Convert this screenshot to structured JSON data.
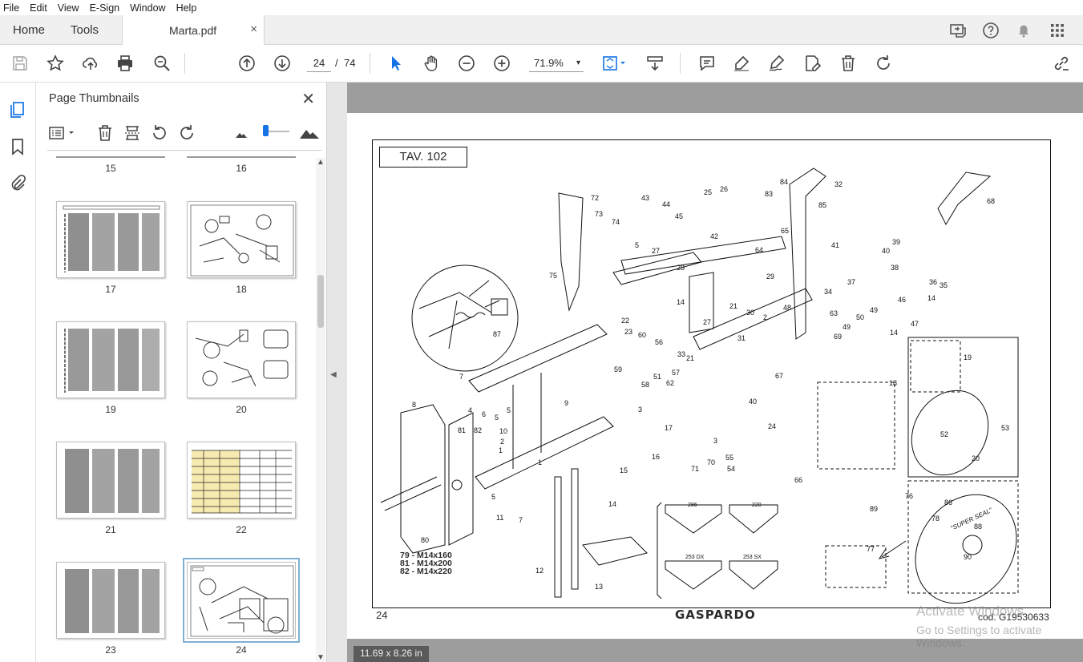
{
  "menu": [
    "File",
    "Edit",
    "View",
    "E-Sign",
    "Window",
    "Help"
  ],
  "tabs": {
    "home": "Home",
    "tools": "Tools",
    "document": "Marta.pdf",
    "close": "×"
  },
  "toolbar": {
    "current_page": "24",
    "page_separator": "/",
    "total_pages": "74",
    "zoom": "71.9%",
    "zoom_arrow": "▾"
  },
  "icons": {
    "top_right": [
      "share-screen-icon",
      "help-icon",
      "bell-icon",
      "apps-grid-icon"
    ],
    "toolbar": [
      "save-icon",
      "star-icon",
      "upload-icon",
      "print-icon",
      "zoom-search-icon",
      "page-up-icon",
      "page-down-icon",
      "select-arrow-icon",
      "hand-icon",
      "zoom-out-icon",
      "zoom-in-icon",
      "fit-page-icon",
      "scroll-mode-icon",
      "comment-icon",
      "highlight-icon",
      "sign-icon",
      "edit-icon",
      "delete-icon",
      "rotate-icon",
      "share-link-icon"
    ]
  },
  "panel": {
    "title": "Page Thumbnails",
    "close": "✕",
    "thumbnails": [
      {
        "label": "15"
      },
      {
        "label": "16"
      },
      {
        "label": "17"
      },
      {
        "label": "18"
      },
      {
        "label": "19"
      },
      {
        "label": "20"
      },
      {
        "label": "21"
      },
      {
        "label": "22"
      },
      {
        "label": "23"
      },
      {
        "label": "24"
      }
    ]
  },
  "document": {
    "table_title": "TAV. 102",
    "page_number": "24",
    "brand": "GASPARDO",
    "code": "cod. G19530633",
    "bolt_specs": [
      "79 - M14x160",
      "81 - M14x200",
      "82 - M14x220"
    ],
    "page_size": "11.69 x 8.26 in",
    "watermark_title": "Activate Windows",
    "watermark_sub": "Go to Settings to activate Windows."
  },
  "colors": {
    "accent": "#1473e6",
    "background_gray": "#9d9d9d"
  }
}
